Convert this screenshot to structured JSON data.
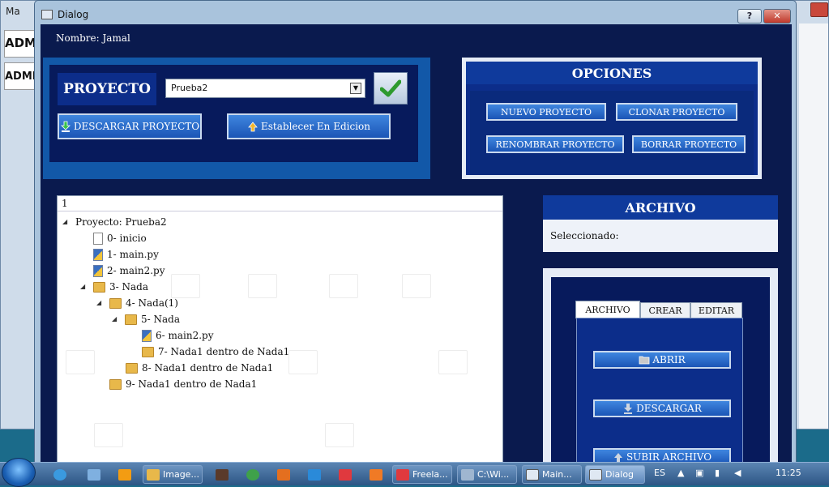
{
  "background_window": {
    "title": "Ma",
    "adm_labels": [
      "ADM",
      "ADMI"
    ]
  },
  "dialog": {
    "title": "Dialog",
    "help_label": "?",
    "close_label": "✕",
    "nombre_label": "Nombre: Jamal"
  },
  "proyecto": {
    "label": "PROYECTO",
    "selected": "Prueba2",
    "download_label": "DESCARGAR PROYECTO",
    "set_edit_label": "Establecer En Edicion"
  },
  "opciones": {
    "title": "OPCIONES",
    "buttons": [
      "NUEVO PROYECTO",
      "CLONAR PROYECTO",
      "RENOMBRAR PROYECTO",
      "BORRAR PROYECTO"
    ]
  },
  "tree": {
    "header": "1",
    "items": [
      {
        "label": "Proyecto: Prueba2",
        "icon": "none",
        "expanded": true
      },
      {
        "label": "0- inicio",
        "icon": "file"
      },
      {
        "label": "1- main.py",
        "icon": "python"
      },
      {
        "label": "2- main2.py",
        "icon": "python"
      },
      {
        "label": "3- Nada",
        "icon": "folder",
        "expanded": true
      },
      {
        "label": "4- Nada(1)",
        "icon": "folder",
        "expanded": true
      },
      {
        "label": "5- Nada",
        "icon": "folder",
        "expanded": true
      },
      {
        "label": "6- main2.py",
        "icon": "python"
      },
      {
        "label": "7- Nada1 dentro de Nada1",
        "icon": "folder"
      },
      {
        "label": "8- Nada1 dentro de Nada1",
        "icon": "folder"
      },
      {
        "label": "9- Nada1 dentro de Nada1",
        "icon": "folder"
      }
    ]
  },
  "archivo": {
    "title": "ARCHIVO",
    "selected_label": "Seleccionado:",
    "tabs": [
      "ARCHIVO",
      "CREAR",
      "EDITAR"
    ],
    "buttons": [
      "ABRIR",
      "DESCARGAR",
      "SUBIR ARCHIVO"
    ]
  },
  "taskbar": {
    "items": [
      "Image...",
      "Freela...",
      "C:\\Wi...",
      "Main...",
      "Dialog"
    ],
    "language": "ES",
    "time": "11:25"
  },
  "colors": {
    "panel_dark": "#0a1a4e",
    "button_blue": "#2a6cd0",
    "accent_green": "#2e9a2e"
  }
}
